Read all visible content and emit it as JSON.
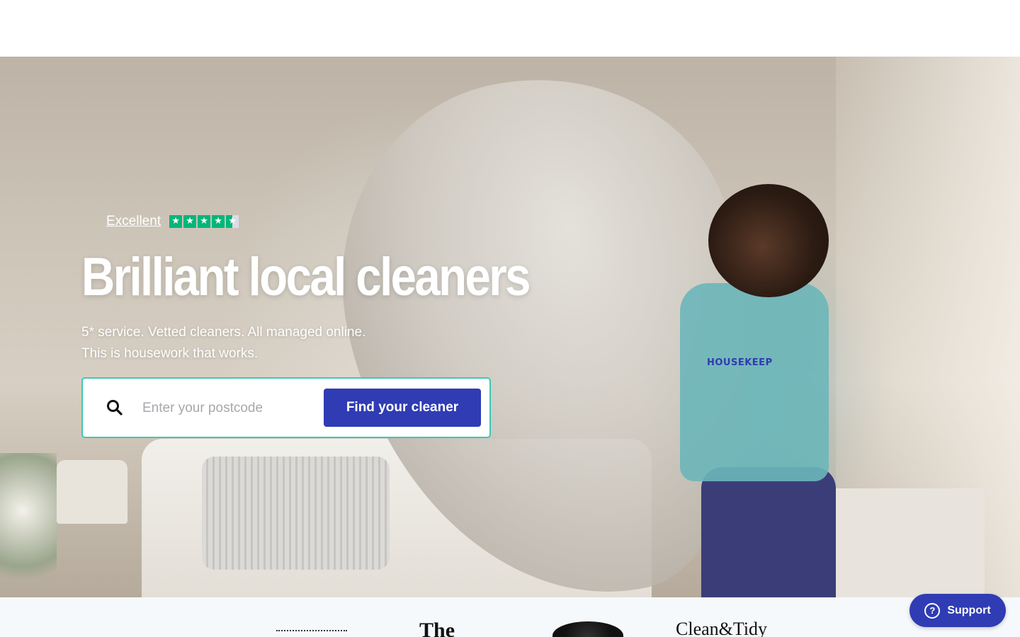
{
  "trustpilot": {
    "label": "Excellent",
    "stars": 4.5,
    "star_glyph": "★",
    "star_color": "#00b67a"
  },
  "hero": {
    "headline": "Brilliant local cleaners",
    "sub_line1": "5* service. Vetted cleaners. All managed online.",
    "sub_line2": "This is housework that works.",
    "shirt_text": "HOUSEKEEP"
  },
  "search": {
    "placeholder": "Enter your postcode",
    "value": "",
    "button_label": "Find your cleaner",
    "accent": "#2f3cb4",
    "border_color": "#3fc7b7"
  },
  "press": {
    "logo_the": "The",
    "logo_clean": "Clean&Tidy"
  },
  "support": {
    "label": "Support",
    "icon": "?"
  }
}
